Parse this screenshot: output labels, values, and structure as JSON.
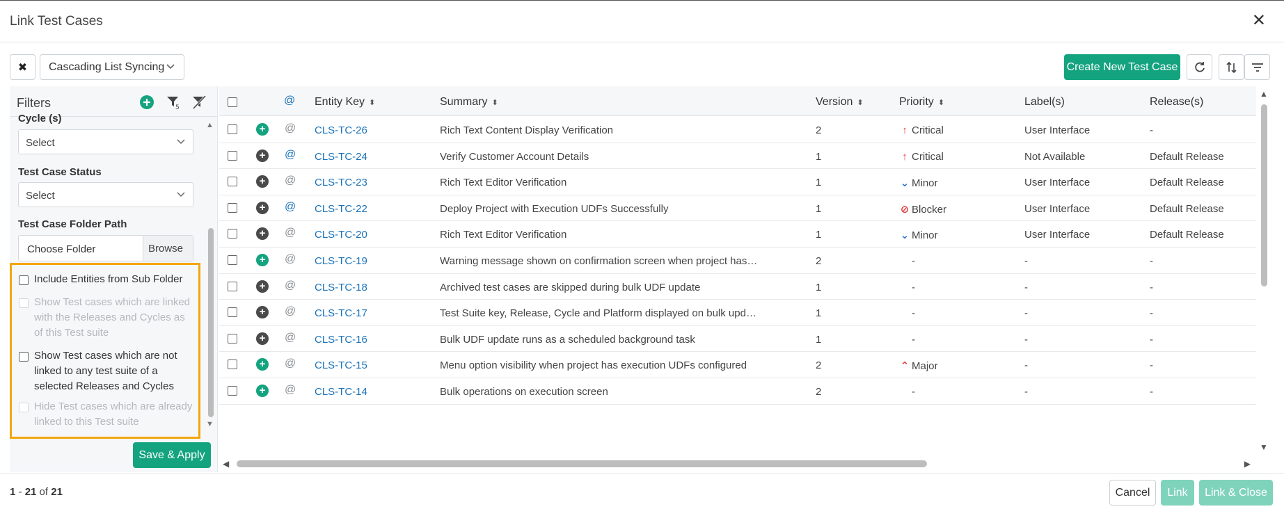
{
  "modal": {
    "title": "Link Test Cases"
  },
  "toolbar": {
    "clear_glyph": "✖",
    "saved_filter": "Cascading List Syncing",
    "create_label": "Create New Test Case"
  },
  "filters": {
    "title": "Filters",
    "cycle_label": "Cycle (s)",
    "cycle_value": "Select",
    "status_label": "Test Case Status",
    "status_value": "Select",
    "folder_label": "Test Case Folder Path",
    "folder_placeholder": "Choose Folder",
    "browse_label": "Browse",
    "options": [
      {
        "label": "Include Entities from Sub Folder",
        "enabled": true
      },
      {
        "label": "Show Test cases which are linked with the Releases and Cycles as of this Test suite",
        "enabled": false
      },
      {
        "label": "Show Test cases which are not linked to any test suite of a selected Releases and Cycles",
        "enabled": true
      },
      {
        "label": "Hide Test cases which are already linked to this Test suite",
        "enabled": false
      }
    ],
    "save_apply_label": "Save & Apply"
  },
  "table": {
    "headers": {
      "at": "@",
      "entity_key": "Entity Key",
      "summary": "Summary",
      "version": "Version",
      "priority": "Priority",
      "labels": "Label(s)",
      "releases": "Release(s)"
    },
    "rows": [
      {
        "add": "green",
        "at": "gray",
        "key": "CLS-TC-26",
        "summary": "Rich Text Content Display Verification",
        "version": "2",
        "priority": "Critical",
        "picon": "critical",
        "label": "User Interface",
        "release": "-"
      },
      {
        "add": "dark",
        "at": "blue",
        "key": "CLS-TC-24",
        "summary": "Verify Customer Account Details",
        "version": "1",
        "priority": "Critical",
        "picon": "critical",
        "label": "Not Available",
        "release": "Default Release"
      },
      {
        "add": "dark",
        "at": "gray",
        "key": "CLS-TC-23",
        "summary": "Rich Text Editor Verification",
        "version": "1",
        "priority": "Minor",
        "picon": "minor",
        "label": "User Interface",
        "release": "Default Release"
      },
      {
        "add": "dark",
        "at": "blue",
        "key": "CLS-TC-22",
        "summary": "Deploy Project with Execution UDFs Successfully",
        "version": "1",
        "priority": "Blocker",
        "picon": "blocker",
        "label": "User Interface",
        "release": "Default Release"
      },
      {
        "add": "dark",
        "at": "gray",
        "key": "CLS-TC-20",
        "summary": "Rich Text Editor Verification",
        "version": "1",
        "priority": "Minor",
        "picon": "minor",
        "label": "User Interface",
        "release": "Default Release"
      },
      {
        "add": "green",
        "at": "gray",
        "key": "CLS-TC-19",
        "summary": "Warning message shown on confirmation screen when project has execu...",
        "version": "2",
        "priority": "-",
        "picon": "",
        "label": "-",
        "release": "-"
      },
      {
        "add": "dark",
        "at": "gray",
        "key": "CLS-TC-18",
        "summary": "Archived test cases are skipped during bulk UDF update",
        "version": "1",
        "priority": "-",
        "picon": "",
        "label": "-",
        "release": "-"
      },
      {
        "add": "dark",
        "at": "gray",
        "key": "CLS-TC-17",
        "summary": "Test Suite key, Release, Cycle and Platform displayed on bulk update scre...",
        "version": "1",
        "priority": "-",
        "picon": "",
        "label": "-",
        "release": "-"
      },
      {
        "add": "dark",
        "at": "gray",
        "key": "CLS-TC-16",
        "summary": "Bulk UDF update runs as a scheduled background task",
        "version": "1",
        "priority": "-",
        "picon": "",
        "label": "-",
        "release": "-"
      },
      {
        "add": "green",
        "at": "gray",
        "key": "CLS-TC-15",
        "summary": "Menu option visibility when project has execution UDFs configured",
        "version": "2",
        "priority": "Major",
        "picon": "major",
        "label": "-",
        "release": "-"
      },
      {
        "add": "green",
        "at": "gray",
        "key": "CLS-TC-14",
        "summary": "Bulk operations on execution screen",
        "version": "2",
        "priority": "-",
        "picon": "",
        "label": "-",
        "release": "-"
      }
    ]
  },
  "footer": {
    "range_start": "1",
    "range_sep": " - ",
    "range_end": "21",
    "of_text": " of ",
    "total": "21",
    "cancel_label": "Cancel",
    "link_label": "Link",
    "link_close_label": "Link & Close"
  },
  "colors": {
    "accent": "#14a37f",
    "link": "#1b73b9",
    "highlight": "#f3a60f",
    "critical": "#e03c3c",
    "minor": "#2c6fd1"
  }
}
